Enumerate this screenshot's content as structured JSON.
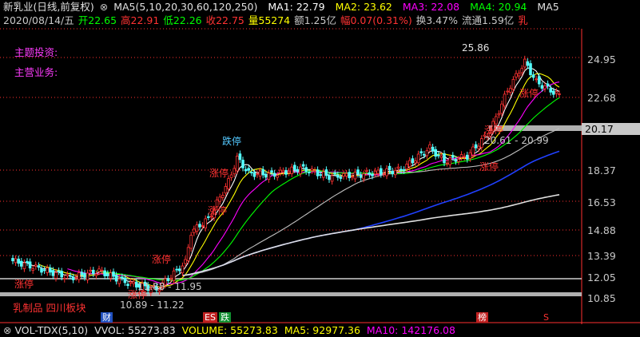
{
  "header": {
    "stock_title": "新乳业(日线,前复权)",
    "ma_params": "MA5(5,10,20,30,60,120,250)",
    "ma1": "MA1: 22.79",
    "ma2": "MA2: 23.62",
    "ma3": "MA3: 22.08",
    "ma4": "MA4: 20.94",
    "ma5": "MA5"
  },
  "quote": {
    "date": "2020/08/14/五",
    "open": "开22.65",
    "high": "高22.91",
    "low": "低22.26",
    "close": "收22.75",
    "volume": "量55274",
    "amount": "额1.25亿",
    "change": "幅0.07(0.31%)",
    "turnover": "换3.47%",
    "float": "流通1.59亿",
    "tail": "乳"
  },
  "side": {
    "theme_label": "主题投资:",
    "business_label": "主营业务:",
    "sector_label": "乳制品 四川板块"
  },
  "y_axis": {
    "ticks": [
      "24.95",
      "22.68",
      "20.17",
      "18.37",
      "16.53",
      "14.88",
      "13.39",
      "12.05",
      "10.85"
    ],
    "current_price": "20.17"
  },
  "annotations": {
    "high_price": "25.86",
    "zhangting_1": "涨停",
    "zhangting_2": "涨停",
    "zhangting_3": "涨停",
    "zhangting_4": "涨停",
    "zhangting_5": "涨停",
    "zhangting_6": "涨停",
    "dieting": "跌停",
    "range_1": "11.88 - 11.95",
    "range_2": "10.89 - 11.22",
    "range_3": "20.61 - 20.99",
    "marker_cai": "财",
    "marker_es": "ES",
    "marker_die": "跌",
    "marker_bang": "榜",
    "marker_s": "S"
  },
  "volume_bar": {
    "label": "VOL-TDX(5,10)",
    "vvol": "VVOL: 55273.83",
    "volume": "VOLUME: 55273.83",
    "ma5": "MA5: 92977.36",
    "ma10": "MA10: 142176.08"
  },
  "colors": {
    "up": "#ff3232",
    "down": "#54ffff",
    "ma1": "#ffffff",
    "ma2": "#ffff00",
    "ma3": "#ff00ff",
    "ma4": "#00ff00",
    "ma5": "#c0c0c0",
    "ma6": "#2040ff",
    "ma7": "#e0e0e0"
  }
}
